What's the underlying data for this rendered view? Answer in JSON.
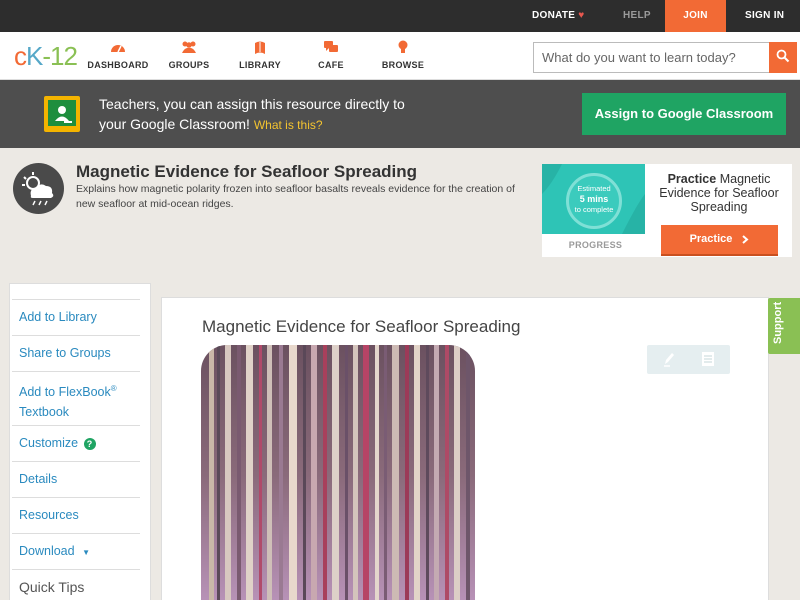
{
  "topbar": {
    "donate": "DONATE",
    "help": "HELP",
    "join": "JOIN",
    "signin": "SIGN IN"
  },
  "logo": {
    "c": "c",
    "k": "K",
    "dash": "-",
    "num": "12"
  },
  "nav": {
    "items": [
      {
        "label": "DASHBOARD"
      },
      {
        "label": "GROUPS"
      },
      {
        "label": "LIBRARY"
      },
      {
        "label": "CAFE"
      },
      {
        "label": "BROWSE"
      }
    ]
  },
  "search": {
    "placeholder": "What do you want to learn today?"
  },
  "banner": {
    "text_line1": "Teachers, you can assign this resource directly to",
    "text_line2": "your Google Classroom!",
    "what_link": "What is this?",
    "assign_button": "Assign to Google Classroom"
  },
  "resource": {
    "title": "Magnetic Evidence for Seafloor Spreading",
    "description": "Explains how magnetic polarity frozen into seafloor basalts reveals evidence for the creation of new seafloor at mid-ocean ridges."
  },
  "practice": {
    "estimated": "Estimated",
    "mins": "5 mins",
    "to_complete": "to complete",
    "progress_label": "PROGRESS",
    "practice_bold": "Practice",
    "practice_rest": "Magnetic Evidence for Seafloor Spreading",
    "button": "Practice"
  },
  "sidebar": {
    "items": [
      {
        "label": "Add to Library"
      },
      {
        "label": "Share to Groups"
      },
      {
        "label": "Add to FlexBook",
        "sup": "®",
        "label2": "Textbook"
      },
      {
        "label": "Customize",
        "badge": "?"
      },
      {
        "label": "Details"
      },
      {
        "label": "Resources"
      },
      {
        "label": "Download",
        "caret": "▼"
      },
      {
        "label": "Quick Tips"
      }
    ]
  },
  "content": {
    "title": "Magnetic Evidence for Seafloor Spreading"
  },
  "support": {
    "label": "Support"
  },
  "colors": {
    "accent_orange": "#f26a35",
    "google_green": "#1fa463",
    "link_blue": "#2a8abf",
    "support_green": "#8ac054"
  }
}
